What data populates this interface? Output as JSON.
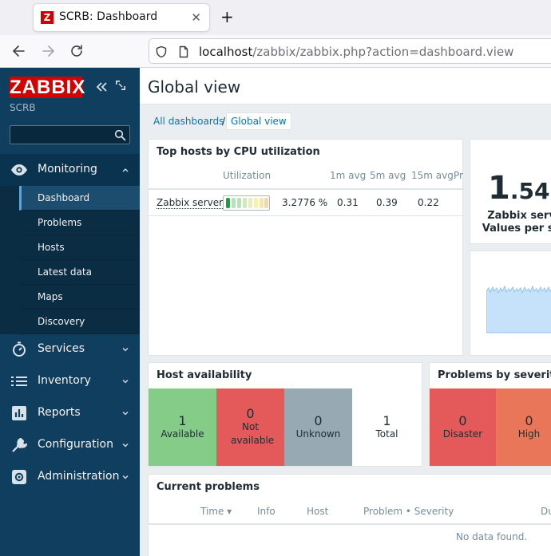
{
  "browser": {
    "tab_title": "SCRB: Dashboard",
    "favicon_letter": "Z",
    "url_host": "localhost",
    "url_path": "/zabbix/zabbix.php?action=dashboard.view"
  },
  "sidebar": {
    "logo": "ZABBIX",
    "server_name": "SCRB",
    "search": {
      "value": "",
      "placeholder": ""
    },
    "menu": [
      {
        "label": "Monitoring",
        "icon": "eye-icon",
        "expanded": true
      },
      {
        "label": "Services",
        "icon": "stopwatch-icon"
      },
      {
        "label": "Inventory",
        "icon": "list-icon"
      },
      {
        "label": "Reports",
        "icon": "bar-chart-icon"
      },
      {
        "label": "Configuration",
        "icon": "wrench-icon"
      },
      {
        "label": "Administration",
        "icon": "gear-icon"
      }
    ],
    "monitoring_items": [
      "Dashboard",
      "Problems",
      "Hosts",
      "Latest data",
      "Maps",
      "Discovery"
    ]
  },
  "header": {
    "title": "Global view"
  },
  "breadcrumb": {
    "parent": "All dashboards",
    "separator": "/",
    "current": "Global view"
  },
  "top_hosts": {
    "title": "Top hosts by CPU utilization",
    "columns": [
      "Utilization",
      "1m avg",
      "5m avg",
      "15m avg",
      "Pr"
    ],
    "rows": [
      {
        "host": "Zabbix server",
        "utilization": "3.2776 %",
        "utilization_fraction": 0.033,
        "avg1": "0.31",
        "avg5": "0.39",
        "avg15": "0.22"
      }
    ]
  },
  "item_value": {
    "value_int": "1",
    "value_dec": ".54",
    "line1": "Zabbix serv",
    "line2": "Values per se"
  },
  "host_availability": {
    "title": "Host availability",
    "cells": [
      {
        "count": "1",
        "label": "Available",
        "color": "#86cc89"
      },
      {
        "count": "0",
        "label": "Not available",
        "color": "#e45959"
      },
      {
        "count": "0",
        "label": "Unknown",
        "color": "#97aab3"
      },
      {
        "count": "1",
        "label": "Total",
        "color": "#ffffff"
      }
    ]
  },
  "problems_by_severity": {
    "title": "Problems by severity",
    "cells": [
      {
        "count": "0",
        "label": "Disaster",
        "color": "#e45959"
      },
      {
        "count": "0",
        "label": "High",
        "color": "#e97659"
      }
    ]
  },
  "current_problems": {
    "title": "Current problems",
    "columns": [
      "Time ▾",
      "Info",
      "Host",
      "Problem • Severity",
      "Du"
    ],
    "empty_text": "No data found."
  },
  "colors": {
    "sidebar_bg": "#0f3e5e",
    "brand_red": "#d40000",
    "link_blue": "#0275b8"
  }
}
